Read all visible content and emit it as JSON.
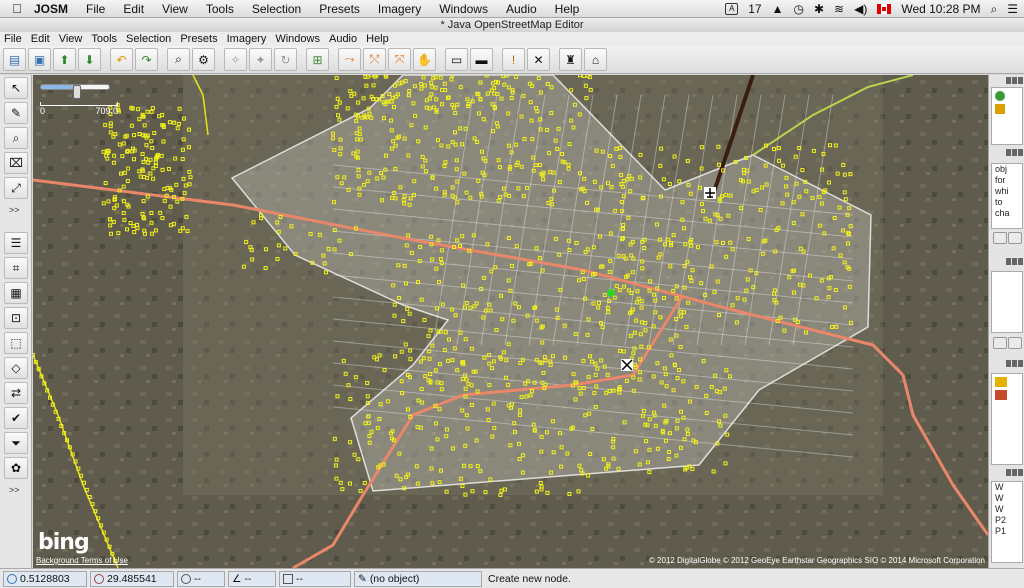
{
  "macbar": {
    "app_name": "JOSM",
    "menus": [
      "File",
      "Edit",
      "View",
      "Tools",
      "Selection",
      "Presets",
      "Imagery",
      "Windows",
      "Audio",
      "Help"
    ],
    "calendar_badge": "17",
    "clock": "Wed 10:28 PM"
  },
  "window_title": "* Java OpenStreetMap Editor",
  "appmenu": [
    "File",
    "Edit",
    "View",
    "Tools",
    "Selection",
    "Presets",
    "Imagery",
    "Windows",
    "Audio",
    "Help"
  ],
  "toolbar": {
    "buttons": [
      "open-file",
      "save",
      "upload",
      "download",
      "undo",
      "redo",
      "zoom",
      "preferences",
      "wireframe",
      "shape",
      "refresh",
      "select-all",
      "merge",
      "split",
      "combine",
      "hand",
      "car",
      "bus",
      "warning",
      "delete",
      "bridge",
      "factory"
    ]
  },
  "left_tools": {
    "more_label": ">>"
  },
  "right_panel": {
    "text_lines": [
      "obj",
      "for",
      "whi",
      "to",
      "cha"
    ],
    "list_labels": [
      "W",
      "W",
      "W",
      "P2",
      "P1"
    ]
  },
  "map": {
    "zoom_level": 0.52,
    "scale_left": "0",
    "scale_right": "709.0",
    "bing_logo": "bing",
    "background_terms": "Background Terms of Use",
    "attribution": "© 2012 DigitalGlobe © 2012 GeoEye Earthstar Geographics  SIO © 2014 Microsoft Corporation"
  },
  "status": {
    "latitude": "0.5128803",
    "longitude": "29.485541",
    "heading": "--",
    "angle": "--",
    "distance": "--",
    "object": "(no object)",
    "help_text": "Create new node."
  },
  "colors": {
    "nodes": "#f2f21a",
    "primary_road": "#e9876a",
    "selection_area": "#ffffff",
    "accent": "#4a90e2"
  }
}
